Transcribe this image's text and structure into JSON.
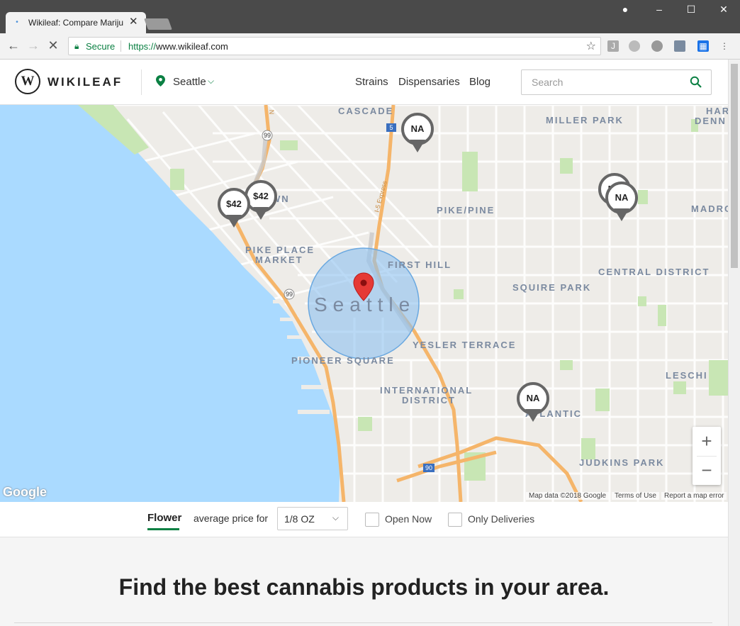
{
  "browser": {
    "tab_title": "Wikileaf: Compare Mariju",
    "tab_close": "✕",
    "secure_label": "Secure",
    "url_scheme": "https://",
    "url_host": "www.wikileaf.com"
  },
  "header": {
    "logo_mark": "W",
    "logo_text": "WIKILEAF",
    "location": "Seattle",
    "nav": [
      "Strains",
      "Dispensaries",
      "Blog"
    ],
    "search_placeholder": "Search"
  },
  "map": {
    "city_label": "Seattle",
    "neighborhoods": [
      "CASCADE",
      "MILLER PARK",
      "HAR",
      "DENN",
      "PIKE/PINE",
      "MADRO",
      "PIKE PLACE",
      "MARKET",
      "FIRST HILL",
      "CENTRAL DISTRICT",
      "SQUIRE PARK",
      "YESLER TERRACE",
      "PIONEER SQUARE",
      "INTERNATIONAL",
      "DISTRICT",
      "LESCHI",
      "ATLANTIC",
      "JUDKINS PARK",
      "WN"
    ],
    "highway_labels": [
      "99",
      "5",
      "99",
      "90",
      "I-5 Express",
      "N"
    ],
    "pins": [
      "NA",
      "$42",
      "$42",
      "NA",
      "NA",
      "NA"
    ],
    "zoom_in": "+",
    "zoom_out": "−",
    "google": "Google",
    "attribution": [
      "Map data ©2018 Google",
      "Terms of Use",
      "Report a map error"
    ]
  },
  "filters": {
    "category": "Flower",
    "avg_label": "average price for",
    "weight": "1/8 OZ",
    "open_now": "Open Now",
    "only_deliveries": "Only Deliveries"
  },
  "content": {
    "headline": "Find the best cannabis products in your area."
  },
  "colors": {
    "accent": "#0b8043",
    "pin_red": "#e53935",
    "water": "#aadaff",
    "radius_fill": "#8ec2f0"
  }
}
